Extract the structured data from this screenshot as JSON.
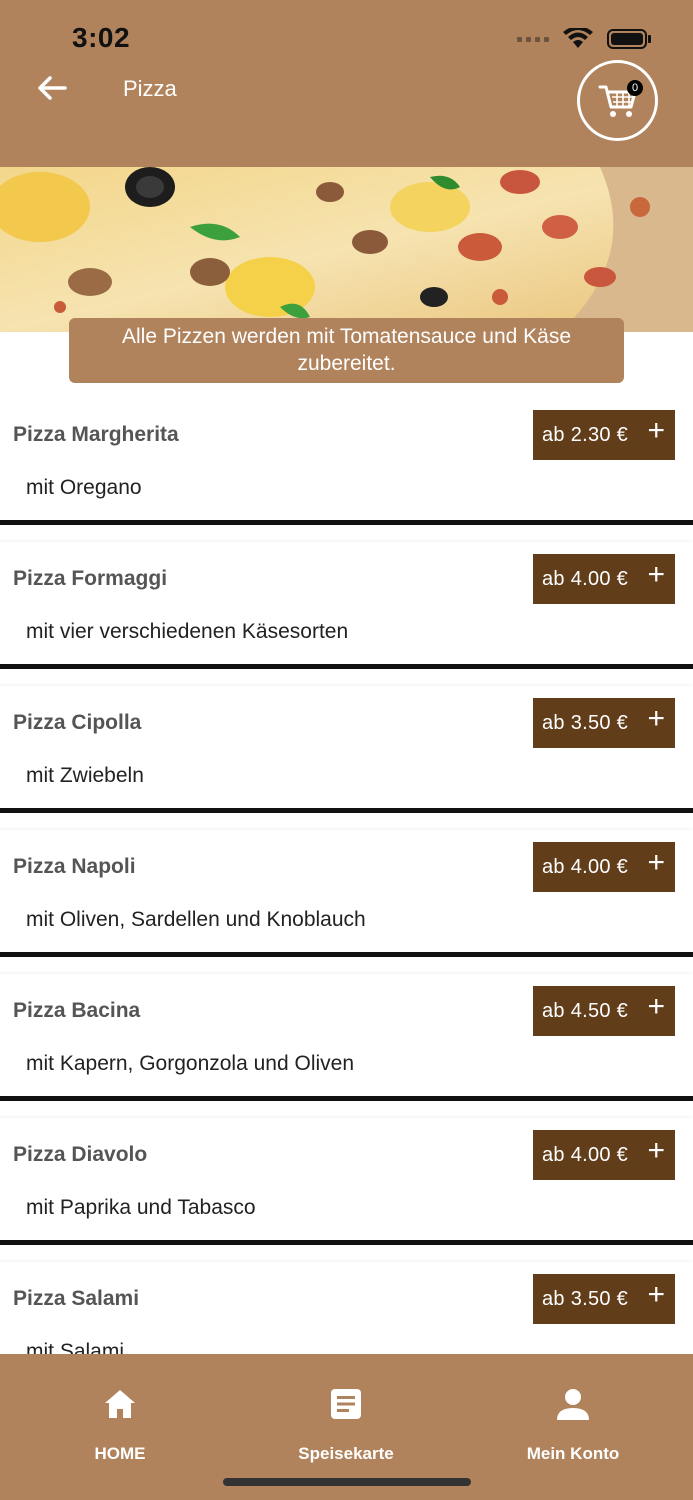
{
  "status_bar": {
    "time": "3:02"
  },
  "header": {
    "title": "Pizza",
    "cart_count": "0"
  },
  "banner": {
    "line1": "Alle Pizzen werden mit Tomatensauce und Käse",
    "line2": "zubereitet."
  },
  "items": [
    {
      "name": "Pizza Margherita",
      "desc": "mit Oregano",
      "price": "ab 2.30 €"
    },
    {
      "name": "Pizza Formaggi",
      "desc": "mit vier verschiedenen Käsesorten",
      "price": "ab 4.00 €"
    },
    {
      "name": "Pizza Cipolla",
      "desc": "mit Zwiebeln",
      "price": "ab 3.50 €"
    },
    {
      "name": "Pizza Napoli",
      "desc": "mit Oliven, Sardellen und Knoblauch",
      "price": "ab 4.00 €"
    },
    {
      "name": "Pizza Bacina",
      "desc": "mit Kapern, Gorgonzola und Oliven",
      "price": "ab 4.50 €"
    },
    {
      "name": "Pizza Diavolo",
      "desc": "mit Paprika und Tabasco",
      "price": "ab 4.00 €"
    },
    {
      "name": "Pizza Salami",
      "desc": "mit Salami",
      "price": "ab 3.50 €"
    }
  ],
  "plus_symbol": "+",
  "nav": {
    "home": "HOME",
    "menu": "Speisekarte",
    "account": "Mein Konto"
  },
  "colors": {
    "header": "#b0835d",
    "price_button": "#623d1a",
    "nav": "#b0835d"
  },
  "icons": {
    "back": "arrow-left-icon",
    "cart": "shopping-cart-icon",
    "home": "home-icon",
    "menu": "document-icon",
    "account": "person-icon"
  }
}
